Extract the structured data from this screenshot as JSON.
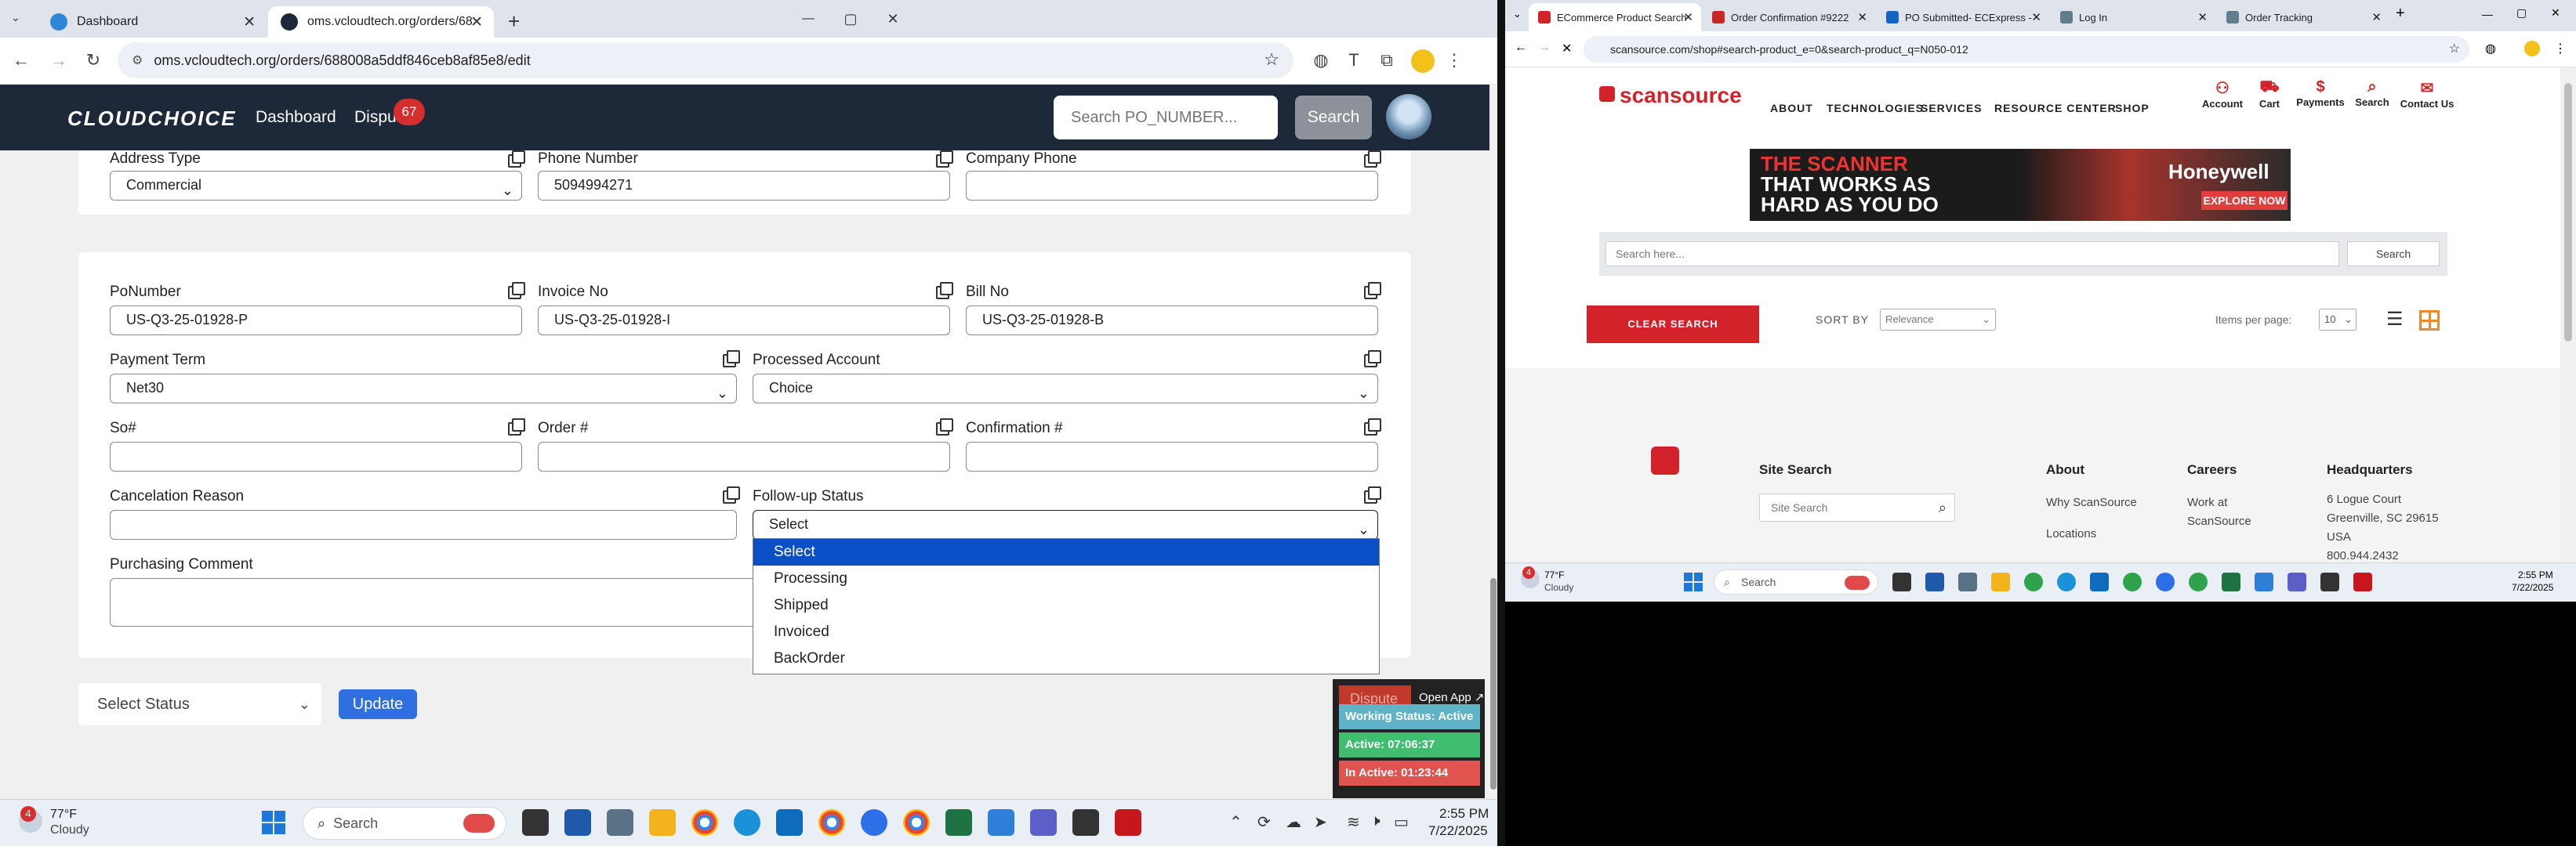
{
  "left_browser": {
    "tabs": [
      {
        "title": "Dashboard",
        "active": false
      },
      {
        "title": "oms.vcloudtech.org/orders/68",
        "active": true
      }
    ],
    "new_tab": "+",
    "url": "oms.vcloudtech.org/orders/688008a5ddf846ceb8af85e8/edit",
    "window_controls": {
      "minimize": "—",
      "maximize": "▢",
      "close": "✕"
    }
  },
  "app": {
    "logo": "CLOUDCHOICE",
    "nav": {
      "dashboard": "Dashboard",
      "disputes": "Dispu",
      "disputes_badge": "67"
    },
    "search": {
      "placeholder": "Search PO_NUMBER...",
      "button": "Search"
    }
  },
  "form": {
    "address_type": {
      "label": "Address Type",
      "value": "Commercial"
    },
    "phone_number": {
      "label": "Phone Number",
      "value": "5094994271"
    },
    "company_phone": {
      "label": "Company Phone",
      "value": ""
    },
    "po_number": {
      "label": "PoNumber",
      "value": "US-Q3-25-01928-P"
    },
    "invoice_no": {
      "label": "Invoice No",
      "value": "US-Q3-25-01928-I"
    },
    "bill_no": {
      "label": "Bill No",
      "value": "US-Q3-25-01928-B"
    },
    "payment_term": {
      "label": "Payment Term",
      "value": "Net30"
    },
    "processed_account": {
      "label": "Processed Account",
      "value": "Choice"
    },
    "so_number": {
      "label": "So#",
      "value": ""
    },
    "order_number": {
      "label": "Order #",
      "value": ""
    },
    "confirmation_number": {
      "label": "Confirmation #",
      "value": ""
    },
    "cancelation_reason": {
      "label": "Cancelation Reason",
      "value": ""
    },
    "followup_status": {
      "label": "Follow-up Status",
      "value": "Select",
      "options": [
        "Select",
        "Processing",
        "Shipped",
        "Invoiced",
        "BackOrder"
      ],
      "highlighted": "Select"
    },
    "purchasing_comment": {
      "label": "Purchasing Comment",
      "value": ""
    }
  },
  "footer_actions": {
    "status_select": "Select Status",
    "update_button": "Update"
  },
  "widget": {
    "dispute": "Dispute",
    "open_app": "Open App ↗",
    "working_status": "Working Status: Active",
    "active": "Active: 07:06:37",
    "inactive": "In Active: 01:23:44"
  },
  "left_taskbar": {
    "weather_temp": "77°F",
    "weather_desc": "Cloudy",
    "weather_badge": "4",
    "search": "Search",
    "time": "2:55 PM",
    "date": "7/22/2025"
  },
  "right_browser": {
    "tabs": [
      {
        "title": "ECommerce Product Search",
        "active": true
      },
      {
        "title": "Order Confirmation #9222",
        "active": false
      },
      {
        "title": "PO Submitted- ECExpress -",
        "active": false
      },
      {
        "title": "Log In",
        "active": false
      },
      {
        "title": "Order Tracking",
        "active": false
      }
    ],
    "url": "scansource.com/shop#search-product_e=0&search-product_q=N050-012"
  },
  "scansource": {
    "logo": "scansource",
    "nav": [
      "ABOUT",
      "TECHNOLOGIES",
      "SERVICES",
      "RESOURCE CENTER",
      "SHOP"
    ],
    "icons": [
      {
        "label": "Account",
        "icon": "user-icon"
      },
      {
        "label": "Cart",
        "icon": "cart-icon"
      },
      {
        "label": "Payments",
        "icon": "dollar-icon"
      },
      {
        "label": "Search",
        "icon": "search-icon"
      },
      {
        "label": "Contact Us",
        "icon": "chat-icon"
      }
    ],
    "banner": {
      "headline_1": "THE SCANNER",
      "headline_2": "THAT WORKS AS",
      "headline_3": "HARD AS YOU DO",
      "brand": "Honeywell",
      "cta": "EXPLORE NOW"
    },
    "search_placeholder": "Search here...",
    "search_button": "Search",
    "clear_search": "CLEAR SEARCH",
    "sort_by_label": "SORT BY",
    "sort_value": "Relevance",
    "items_per_page_label": "Items per page:",
    "items_per_page_value": "10",
    "footer": {
      "site_search_title": "Site Search",
      "site_search_placeholder": "Site Search",
      "about_title": "About",
      "about_links": [
        "Why ScanSource",
        "Locations"
      ],
      "careers_title": "Careers",
      "careers_link": "Work at ScanSource",
      "hq_title": "Headquarters",
      "hq_lines": [
        "6 Logue Court",
        "Greenville, SC 29615",
        "USA",
        "800.944.2432"
      ]
    }
  },
  "right_taskbar": {
    "weather_temp": "77°F",
    "weather_desc": "Cloudy",
    "weather_badge": "4",
    "search": "Search",
    "time": "2:55 PM",
    "date": "7/22/2025"
  },
  "colors": {
    "app_nav": "#1d2939",
    "select_highlight": "#0a4fc5",
    "update_button": "#2f6fe0",
    "scansource_red": "#d3232a",
    "widget_teal": "#5fb3c9",
    "widget_green": "#3fbe6f",
    "widget_red": "#e0534f"
  }
}
